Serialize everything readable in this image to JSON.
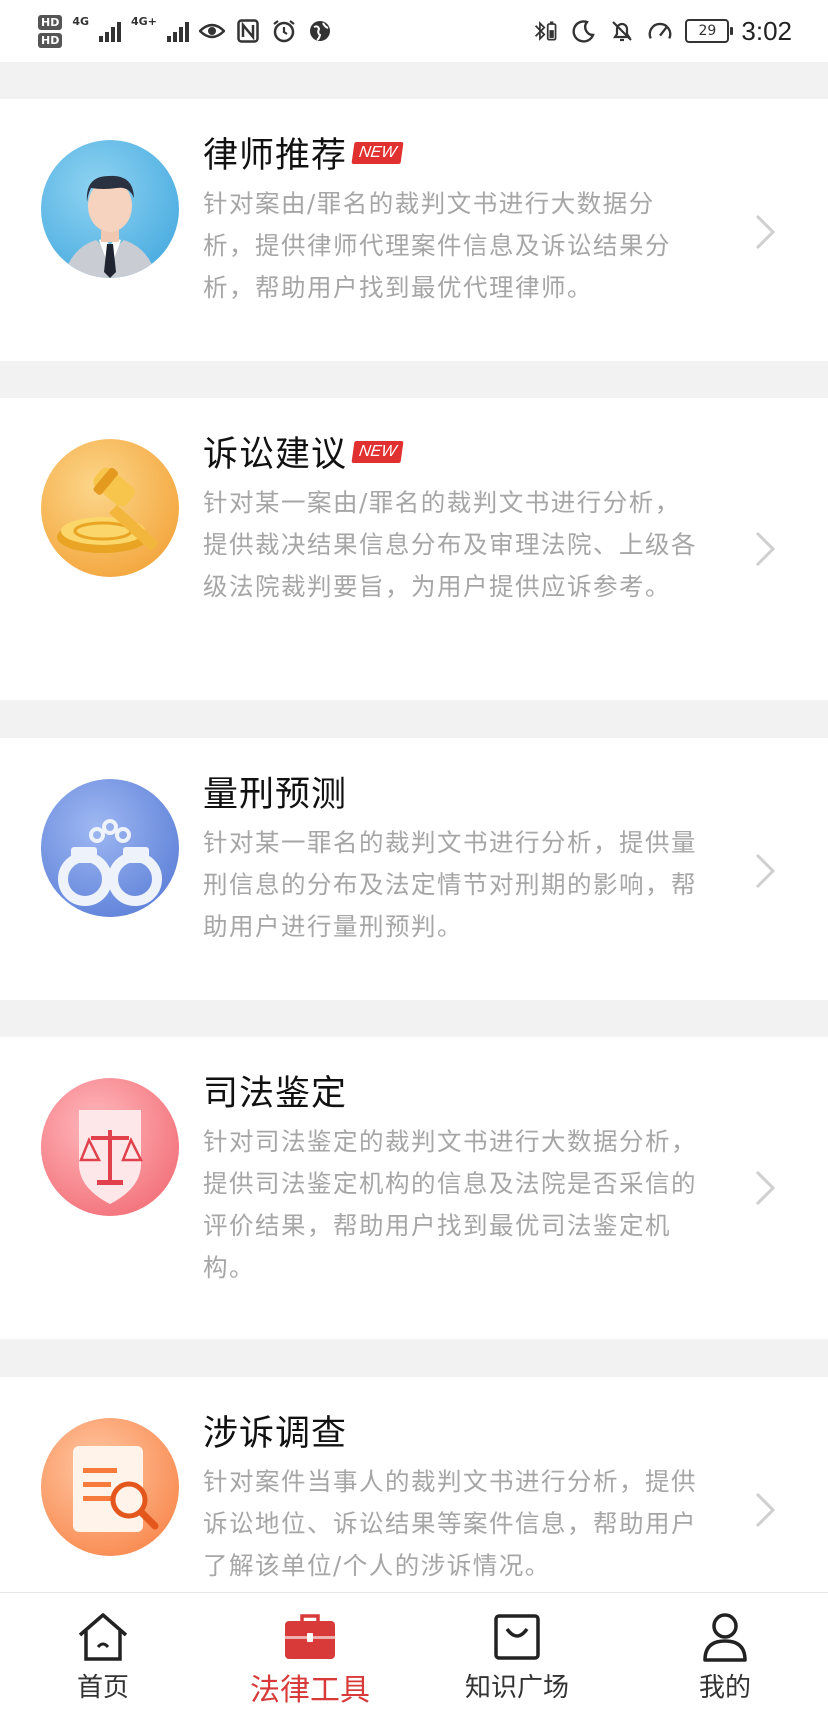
{
  "status_bar": {
    "network_1": "4G",
    "network_2": "4G+",
    "battery": "29",
    "time": "3:02"
  },
  "tools": [
    {
      "title": "律师推荐",
      "badge": "NEW",
      "description": "针对案由/罪名的裁判文书进行大数据分析，提供律师代理案件信息及诉讼结果分析，帮助用户找到最优代理律师。",
      "icon": "lawyer-avatar-icon"
    },
    {
      "title": "诉讼建议",
      "badge": "NEW",
      "description": "针对某一案由/罪名的裁判文书进行分析，提供裁决结果信息分布及审理法院、上级各级法院裁判要旨，为用户提供应诉参考。",
      "icon": "gavel-icon"
    },
    {
      "title": "量刑预测",
      "badge": "",
      "description": "针对某一罪名的裁判文书进行分析，提供量刑信息的分布及法定情节对刑期的影响，帮助用户进行量刑预判。",
      "icon": "handcuffs-icon"
    },
    {
      "title": "司法鉴定",
      "badge": "",
      "description": "针对司法鉴定的裁判文书进行大数据分析，提供司法鉴定机构的信息及法院是否采信的评价结果，帮助用户找到最优司法鉴定机构。",
      "icon": "scales-shield-icon"
    },
    {
      "title": "涉诉调查",
      "badge": "",
      "description": "针对案件当事人的裁判文书进行分析，提供诉讼地位、诉讼结果等案件信息，帮助用户了解该单位/个人的涉诉情况。",
      "icon": "document-search-icon"
    }
  ],
  "bottom_nav": [
    {
      "label": "首页",
      "icon": "home-icon",
      "active": false
    },
    {
      "label": "法律工具",
      "icon": "toolbox-icon",
      "active": true
    },
    {
      "label": "知识广场",
      "icon": "shopping-bag-icon",
      "active": false
    },
    {
      "label": "我的",
      "icon": "user-icon",
      "active": false
    }
  ],
  "colors": {
    "accent": "#d83a3a",
    "badge": "#e0302f",
    "description_text": "#a6a6a6",
    "separator": "#f2f2f2"
  }
}
